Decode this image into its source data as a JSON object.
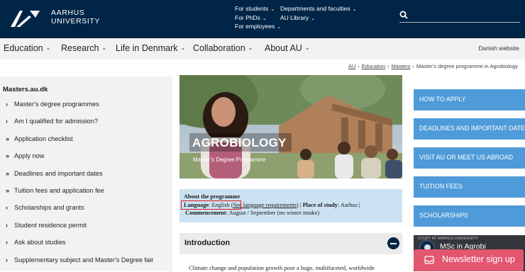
{
  "header": {
    "logo_line1": "AARHUS",
    "logo_line2": "UNIVERSITY",
    "links_col1": [
      {
        "label": "For students"
      },
      {
        "label": "For PhDs"
      },
      {
        "label": "For employees"
      }
    ],
    "links_col2": [
      {
        "label": "Departments and faculties"
      },
      {
        "label": "AU Library"
      }
    ],
    "search_icon": "search-icon"
  },
  "nav": {
    "items": [
      {
        "label": "Education"
      },
      {
        "label": "Research"
      },
      {
        "label": "Life in Denmark"
      },
      {
        "label": "Collaboration"
      },
      {
        "label": "About AU"
      }
    ],
    "danish": "Danish website"
  },
  "breadcrumb": {
    "items": [
      "AU",
      "Education",
      "Masters"
    ],
    "current": "Master's degree programme in Agrobiology"
  },
  "sidebar": {
    "title": "Masters.au.dk",
    "items": [
      {
        "label": "Master's degree programmes"
      },
      {
        "label": "Am I qualified for admission?"
      },
      {
        "label": "Application checklist"
      },
      {
        "label": "Apply now"
      },
      {
        "label": "Deadlines and important dates"
      },
      {
        "label": "Tuition fees and application fee"
      },
      {
        "label": "Scholarships and grants"
      },
      {
        "label": "Student residence permit"
      },
      {
        "label": "Ask about studies"
      },
      {
        "label": "Supplementary subject and Master's Degree fair"
      }
    ]
  },
  "hero": {
    "title": "AGROBIOLOGY",
    "subtitle": "Master's Degree Programme"
  },
  "about": {
    "heading": "About the programme",
    "language_label": "Language",
    "language_value": "English",
    "language_link": "See language requirements",
    "place_label": "Place of study",
    "place_value": "Aarhus",
    "commencement_label": "Commencement",
    "commencement_value": "August / September (no winter intake)"
  },
  "intro": {
    "title": "Introduction",
    "text": "Climate change and population growth pose a huge, multifaceted, worldwide"
  },
  "right_buttons": [
    {
      "label": "HOW TO APPLY"
    },
    {
      "label": "DEADLINES AND IMPORTANT DATES"
    },
    {
      "label": "VISIT AU OR MEET US ABROAD"
    },
    {
      "label": "TUITION FEES"
    },
    {
      "label": "SCHOLARSHIPS"
    }
  ],
  "video": {
    "source": "STUDY AT AARHUS UNIVERSITY",
    "title": "MSc in Agrobi"
  },
  "newsletter": {
    "label": "Newsletter sign up"
  },
  "colors": {
    "header_bg": "#002546",
    "accent_blue": "#4f9bd9",
    "info_box": "#cbe2f2",
    "newsletter": "#e2566f",
    "highlight_box": "#e0191b"
  }
}
